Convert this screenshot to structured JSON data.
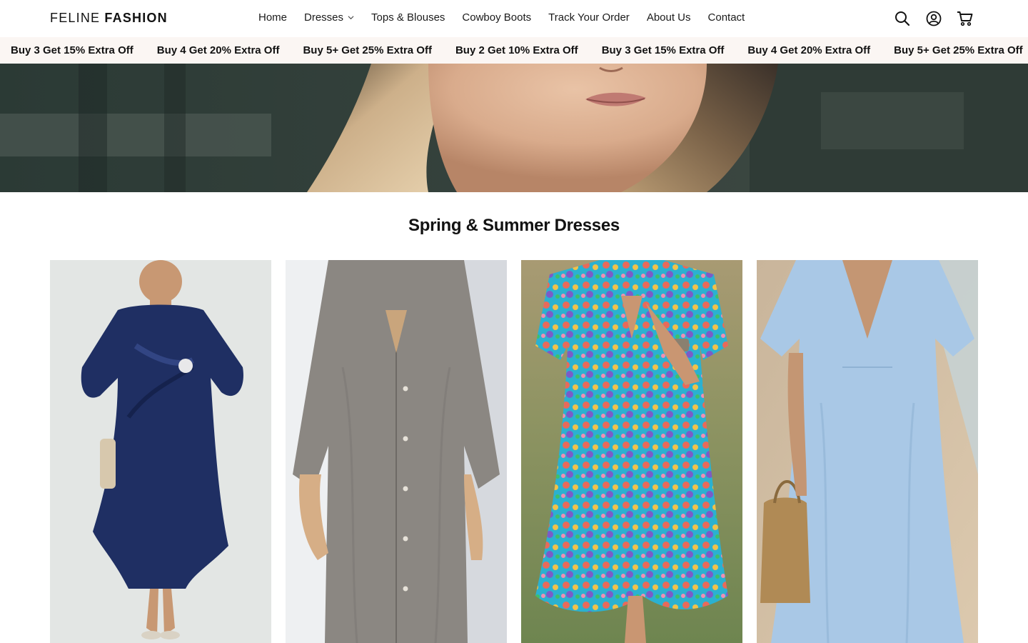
{
  "brand": {
    "name_light": "FELINE",
    "name_bold": "FASHION"
  },
  "nav": {
    "items": [
      {
        "label": "Home"
      },
      {
        "label": "Dresses",
        "has_dropdown": true
      },
      {
        "label": "Tops & Blouses"
      },
      {
        "label": "Cowboy Boots"
      },
      {
        "label": "Track Your Order"
      },
      {
        "label": "About Us"
      },
      {
        "label": "Contact"
      }
    ]
  },
  "header_icons": [
    "search-icon",
    "account-icon",
    "cart-icon"
  ],
  "promo": {
    "items": [
      "Buy 3 Get 15% Extra Off",
      "Buy 4 Get 20% Extra Off",
      "Buy 5+ Get 25% Extra Off",
      "Buy 2 Get 10% Extra Off",
      "Buy 3 Get 15% Extra Off",
      "Buy 4 Get 20% Extra Off",
      "Buy 5+ Get 25% Extra Off"
    ]
  },
  "section": {
    "title": "Spring & Summer Dresses"
  },
  "products": [
    {
      "name": "navy satin dress",
      "color": "#1f2f63"
    },
    {
      "name": "grey linen shirt dress",
      "color": "#8b8782"
    },
    {
      "name": "floral print dress",
      "color": "#3fa9c8"
    },
    {
      "name": "light blue linen dress",
      "color": "#a9c8e6"
    }
  ],
  "colors": {
    "promo_bg": "#fbf6f3",
    "text": "#121212"
  }
}
